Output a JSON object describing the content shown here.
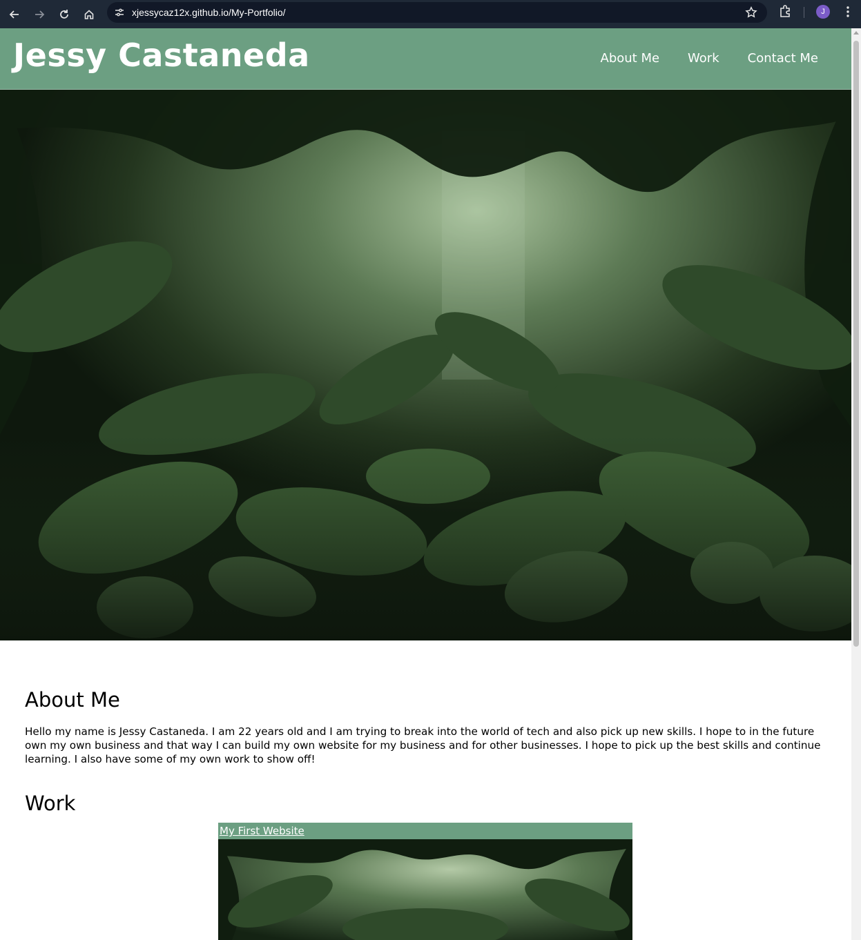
{
  "browser": {
    "url": "xjessycaz12x.github.io/My-Portfolio/",
    "profile_initial": "J"
  },
  "header": {
    "title": "Jessy Castaneda",
    "nav": [
      {
        "label": "About Me"
      },
      {
        "label": "Work"
      },
      {
        "label": "Contact Me"
      }
    ]
  },
  "about": {
    "heading": "About Me",
    "text": "Hello my name is Jessy Castaneda. I am 22 years old and I am trying to break into the world of tech and also pick up new skills. I hope to in the future own my own business and that way I can build my own website for my business and for other businesses. I hope to pick up the best skills and continue learning. I also have some of my own work to show off!"
  },
  "work": {
    "heading": "Work",
    "projects": [
      {
        "title": "My First Website"
      }
    ]
  },
  "colors": {
    "header_bg": "#6c9f82",
    "chrome_bg": "#1f2937"
  },
  "icons": [
    "back-icon",
    "forward-icon",
    "reload-icon",
    "home-icon",
    "site-settings-icon",
    "bookmark-star-icon",
    "extensions-icon",
    "menu-kebab-icon"
  ]
}
